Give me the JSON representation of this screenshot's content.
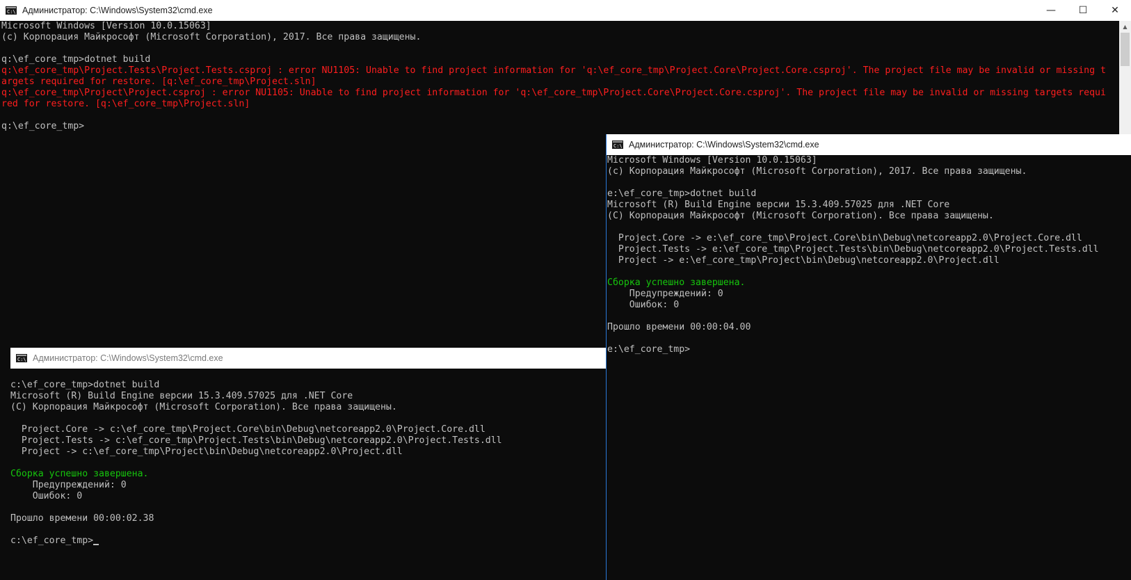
{
  "window1": {
    "title": "Администратор: C:\\Windows\\System32\\cmd.exe",
    "minimize": "—",
    "maximize": "☐",
    "close": "✕",
    "lines": [
      {
        "text": "Microsoft Windows [Version 10.0.15063]",
        "style": "normal"
      },
      {
        "text": "(c) Корпорация Майкрософт (Microsoft Corporation), 2017. Все права защищены.",
        "style": "normal"
      },
      {
        "text": "",
        "style": "normal"
      },
      {
        "text": "q:\\ef_core_tmp>dotnet build",
        "style": "normal"
      },
      {
        "text": "q:\\ef_core_tmp\\Project.Tests\\Project.Tests.csproj : error NU1105: Unable to find project information for 'q:\\ef_core_tmp\\Project.Core\\Project.Core.csproj'. The project file may be invalid or missing t",
        "style": "err"
      },
      {
        "text": "argets required for restore. [q:\\ef_core_tmp\\Project.sln]",
        "style": "err"
      },
      {
        "text": "q:\\ef_core_tmp\\Project\\Project.csproj : error NU1105: Unable to find project information for 'q:\\ef_core_tmp\\Project.Core\\Project.Core.csproj'. The project file may be invalid or missing targets requi",
        "style": "err"
      },
      {
        "text": "red for restore. [q:\\ef_core_tmp\\Project.sln]",
        "style": "err"
      },
      {
        "text": "",
        "style": "normal"
      },
      {
        "text": "q:\\ef_core_tmp>",
        "style": "normal"
      }
    ]
  },
  "window2": {
    "title": "Администратор: C:\\Windows\\System32\\cmd.exe",
    "lines": [
      {
        "text": "Microsoft Windows [Version 10.0.15063]",
        "style": "normal"
      },
      {
        "text": "(c) Корпорация Майкрософт (Microsoft Corporation), 2017. Все права защищены.",
        "style": "normal"
      },
      {
        "text": "",
        "style": "normal"
      },
      {
        "text": "e:\\ef_core_tmp>dotnet build",
        "style": "normal"
      },
      {
        "text": "Microsoft (R) Build Engine версии 15.3.409.57025 для .NET Core",
        "style": "normal"
      },
      {
        "text": "(C) Корпорация Майкрософт (Microsoft Corporation). Все права защищены.",
        "style": "normal"
      },
      {
        "text": "",
        "style": "normal"
      },
      {
        "text": "  Project.Core -> e:\\ef_core_tmp\\Project.Core\\bin\\Debug\\netcoreapp2.0\\Project.Core.dll",
        "style": "normal"
      },
      {
        "text": "  Project.Tests -> e:\\ef_core_tmp\\Project.Tests\\bin\\Debug\\netcoreapp2.0\\Project.Tests.dll",
        "style": "normal"
      },
      {
        "text": "  Project -> e:\\ef_core_tmp\\Project\\bin\\Debug\\netcoreapp2.0\\Project.dll",
        "style": "normal"
      },
      {
        "text": "",
        "style": "normal"
      },
      {
        "text": "Сборка успешно завершена.",
        "style": "ok"
      },
      {
        "text": "    Предупреждений: 0",
        "style": "normal"
      },
      {
        "text": "    Ошибок: 0",
        "style": "normal"
      },
      {
        "text": "",
        "style": "normal"
      },
      {
        "text": "Прошло времени 00:00:04.00",
        "style": "normal"
      },
      {
        "text": "",
        "style": "normal"
      },
      {
        "text": "e:\\ef_core_tmp>",
        "style": "normal"
      }
    ]
  },
  "window3": {
    "title": "Администратор: C:\\Windows\\System32\\cmd.exe",
    "lines": [
      {
        "text": "",
        "style": "normal"
      },
      {
        "text": "c:\\ef_core_tmp>dotnet build",
        "style": "normal"
      },
      {
        "text": "Microsoft (R) Build Engine версии 15.3.409.57025 для .NET Core",
        "style": "normal"
      },
      {
        "text": "(C) Корпорация Майкрософт (Microsoft Corporation). Все права защищены.",
        "style": "normal"
      },
      {
        "text": "",
        "style": "normal"
      },
      {
        "text": "  Project.Core -> c:\\ef_core_tmp\\Project.Core\\bin\\Debug\\netcoreapp2.0\\Project.Core.dll",
        "style": "normal"
      },
      {
        "text": "  Project.Tests -> c:\\ef_core_tmp\\Project.Tests\\bin\\Debug\\netcoreapp2.0\\Project.Tests.dll",
        "style": "normal"
      },
      {
        "text": "  Project -> c:\\ef_core_tmp\\Project\\bin\\Debug\\netcoreapp2.0\\Project.dll",
        "style": "normal"
      },
      {
        "text": "",
        "style": "normal"
      },
      {
        "text": "Сборка успешно завершена.",
        "style": "ok"
      },
      {
        "text": "    Предупреждений: 0",
        "style": "normal"
      },
      {
        "text": "    Ошибок: 0",
        "style": "normal"
      },
      {
        "text": "",
        "style": "normal"
      },
      {
        "text": "Прошло времени 00:00:02.38",
        "style": "normal"
      },
      {
        "text": "",
        "style": "normal"
      },
      {
        "text": "c:\\ef_core_tmp>",
        "style": "normal"
      }
    ]
  }
}
